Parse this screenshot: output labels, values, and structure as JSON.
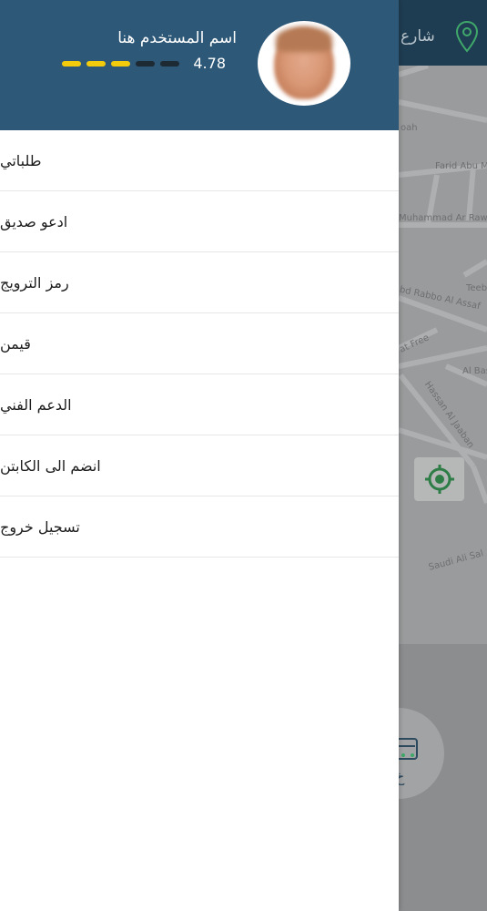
{
  "map": {
    "street_label": "شارع",
    "labels": [
      "oah",
      "Farid Abu M",
      "Muhammad Ar Raw",
      "Teeb",
      "bd Rabbo Al Assaf",
      "at Free",
      "Al Bas",
      "Hassan Al Jaaban",
      "Saudi Ali Sal"
    ]
  },
  "header": {
    "username": "اسم المستخدم هنا",
    "rating": "4.78",
    "stars_filled": 3,
    "stars_total": 5,
    "colors": {
      "filled": "#f2cc0c",
      "empty": "#1d2a33",
      "header_bg": "#2e5878"
    }
  },
  "menu": {
    "items": [
      {
        "label": "طلباتي"
      },
      {
        "label": "ادعو صديق"
      },
      {
        "label": "رمز الترويج"
      },
      {
        "label": "قيمن"
      },
      {
        "label": "الدعم الفني"
      },
      {
        "label": "انضم الى الكابتن"
      },
      {
        "label": "تسجيل خروج"
      }
    ]
  },
  "bottom": {
    "car_text": "خ"
  }
}
